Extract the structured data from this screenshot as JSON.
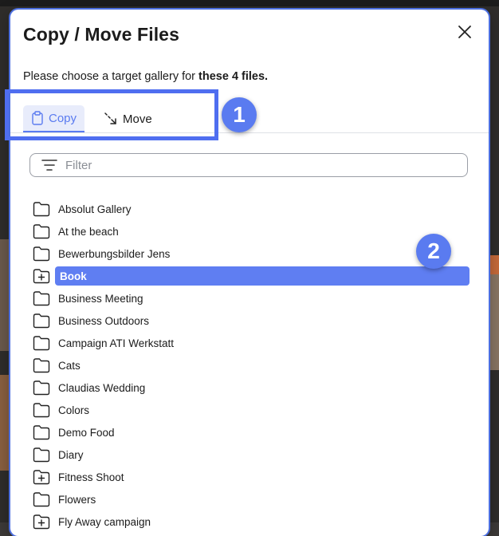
{
  "dialog": {
    "title": "Copy / Move Files",
    "subtitle_prefix": "Please choose a target gallery for ",
    "subtitle_bold": "these 4 files."
  },
  "tabs": [
    {
      "label": "Copy",
      "icon": "clipboard-icon",
      "active": true
    },
    {
      "label": "Move",
      "icon": "move-arrow-icon",
      "active": false
    }
  ],
  "filter": {
    "placeholder": "Filter",
    "value": ""
  },
  "galleries": [
    {
      "name": "Absolut Gallery",
      "icon": "folder"
    },
    {
      "name": "At the beach",
      "icon": "folder"
    },
    {
      "name": "Bewerbungsbilder Jens",
      "icon": "folder"
    },
    {
      "name": "Book",
      "icon": "folder-plus",
      "selected": true
    },
    {
      "name": "Business Meeting",
      "icon": "folder"
    },
    {
      "name": "Business Outdoors",
      "icon": "folder"
    },
    {
      "name": "Campaign ATI Werkstatt",
      "icon": "folder"
    },
    {
      "name": "Cats",
      "icon": "folder"
    },
    {
      "name": "Claudias Wedding",
      "icon": "folder"
    },
    {
      "name": "Colors",
      "icon": "folder"
    },
    {
      "name": "Demo Food",
      "icon": "folder"
    },
    {
      "name": "Diary",
      "icon": "folder"
    },
    {
      "name": "Fitness Shoot",
      "icon": "folder-plus"
    },
    {
      "name": "Flowers",
      "icon": "folder"
    },
    {
      "name": "Fly Away campaign",
      "icon": "folder-plus"
    }
  ],
  "annotations": {
    "badge_1": "1",
    "badge_2": "2"
  },
  "colors": {
    "accent": "#5a7bf0",
    "selected_row": "#5f7ef2",
    "highlight": "#4f6ef0"
  }
}
